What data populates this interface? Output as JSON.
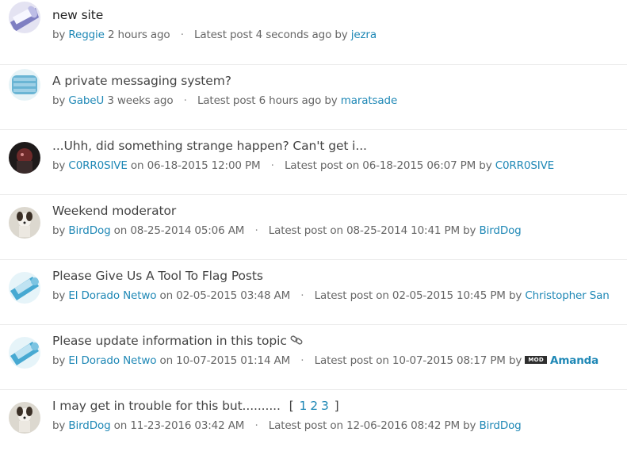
{
  "topics": [
    {
      "title": "new site",
      "author": "Reggie",
      "created": "2 hours ago",
      "latest": "Latest post 4 seconds ago by",
      "last_poster": "jezra"
    },
    {
      "title": "A private messaging system?",
      "author": "GabeU",
      "created": "3 weeks ago",
      "latest": "Latest post 6 hours ago by",
      "last_poster": "maratsade"
    },
    {
      "title": "...Uhh, did something strange happen? Can't get i...",
      "author": "C0RR0SIVE",
      "created": "on 06-18-2015 12:00 PM",
      "latest": "Latest post on 06-18-2015 06:07 PM by",
      "last_poster": "C0RR0SIVE"
    },
    {
      "title": "Weekend moderator",
      "author": "BirdDog",
      "created": "on 08-25-2014 05:06 AM",
      "latest": "Latest post on 08-25-2014 10:41 PM by",
      "last_poster": "BirdDog"
    },
    {
      "title": "Please Give Us A Tool To Flag Posts",
      "author": "El Dorado Netwo",
      "created": "on 02-05-2015 03:48 AM",
      "latest": "Latest post on 02-05-2015 10:45 PM by",
      "last_poster": "Christopher San"
    },
    {
      "title": "Please update information in this topic",
      "author": "El Dorado Netwo",
      "created": "on 10-07-2015 01:14 AM",
      "latest": "Latest post on 10-07-2015 08:17 PM by",
      "last_poster": "Amanda",
      "badge": "MOD",
      "icon": "link-icon"
    },
    {
      "title": "I may get in trouble for this but..........",
      "author": "BirdDog",
      "created": "on 11-23-2016 03:42 AM",
      "latest": "Latest post on 12-06-2016 08:42 PM by",
      "last_poster": "BirdDog",
      "pages": [
        "1",
        "2",
        "3"
      ]
    }
  ],
  "separator": "·",
  "by_label": "by",
  "pages_open": "[",
  "pages_close": "]"
}
